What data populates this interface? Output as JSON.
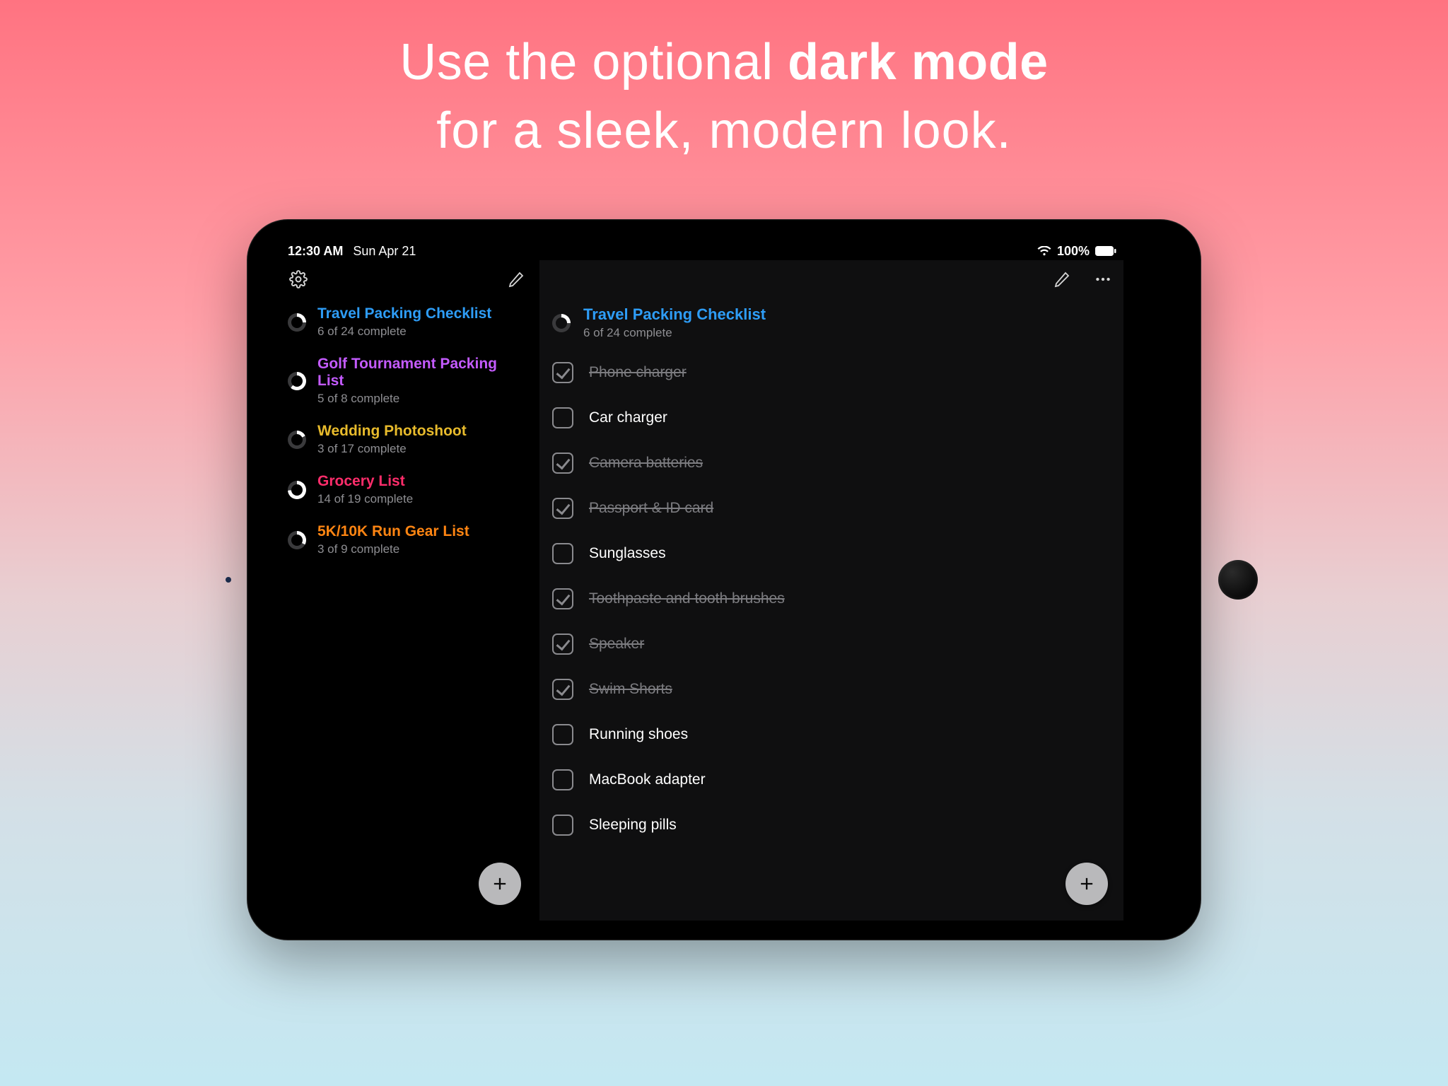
{
  "headline": {
    "prefix": "Use the optional ",
    "bold": "dark mode",
    "line2": "for a sleek, modern look."
  },
  "status": {
    "time": "12:30 AM",
    "date": "Sun Apr 21",
    "battery": "100%"
  },
  "sidebar": {
    "lists": [
      {
        "title": "Travel Packing Checklist",
        "sub": "6 of 24 complete",
        "colorClass": "c-blue",
        "pct": 25
      },
      {
        "title": "Golf Tournament Packing List",
        "sub": "5 of 8 complete",
        "colorClass": "c-purple",
        "pct": 62
      },
      {
        "title": "Wedding Photoshoot",
        "sub": "3 of 17 complete",
        "colorClass": "c-yellow",
        "pct": 18
      },
      {
        "title": "Grocery List",
        "sub": "14 of 19 complete",
        "colorClass": "c-pink",
        "pct": 74
      },
      {
        "title": "5K/10K Run Gear List",
        "sub": "3 of 9 complete",
        "colorClass": "c-orange",
        "pct": 33
      }
    ]
  },
  "detail": {
    "title": "Travel Packing Checklist",
    "sub": "6 of 24 complete",
    "pct": 25,
    "items": [
      {
        "label": "Phone charger",
        "done": true
      },
      {
        "label": "Car charger",
        "done": false
      },
      {
        "label": "Camera batteries",
        "done": true
      },
      {
        "label": "Passport & ID card",
        "done": true
      },
      {
        "label": "Sunglasses",
        "done": false
      },
      {
        "label": "Toothpaste and tooth brushes",
        "done": true
      },
      {
        "label": "Speaker",
        "done": true
      },
      {
        "label": "Swim Shorts",
        "done": true
      },
      {
        "label": "Running shoes",
        "done": false
      },
      {
        "label": "MacBook adapter",
        "done": false
      },
      {
        "label": "Sleeping pills",
        "done": false
      }
    ]
  }
}
